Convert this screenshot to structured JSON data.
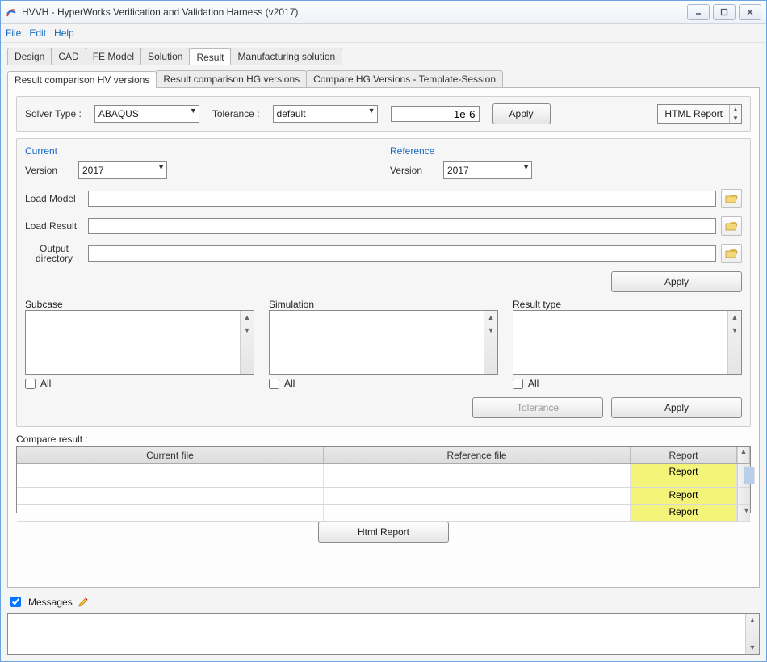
{
  "window": {
    "title": "HVVH - HyperWorks Verification and Validation Harness (v2017)"
  },
  "menu": {
    "file": "File",
    "edit": "Edit",
    "help": "Help"
  },
  "main_tabs": {
    "design": "Design",
    "cad": "CAD",
    "fe": "FE Model",
    "solution": "Solution",
    "result": "Result",
    "manuf": "Manufacturing solution"
  },
  "sub_tabs": {
    "hv": "Result comparison HV versions",
    "hg": "Result comparison HG versions",
    "tpl": "Compare HG Versions - Template-Session"
  },
  "toolbar": {
    "solver_label": "Solver Type :",
    "solver_value": "ABAQUS",
    "tol_label": "Tolerance :",
    "tol_value": "default",
    "num_value": "1e-6",
    "apply": "Apply",
    "html_report": "HTML Report"
  },
  "current": {
    "legend": "Current",
    "version_label": "Version",
    "version_value": "2017"
  },
  "reference": {
    "legend": "Reference",
    "version_label": "Version",
    "version_value": "2017"
  },
  "files": {
    "load_model": "Load Model",
    "load_result": "Load Result",
    "out_dir1": "Output",
    "out_dir2": "directory"
  },
  "apply2": "Apply",
  "lists": {
    "subcase": "Subcase",
    "simulation": "Simulation",
    "result_type": "Result type",
    "all": "All"
  },
  "footer_btns": {
    "tolerance": "Tolerance",
    "apply": "Apply"
  },
  "compare": {
    "title": "Compare result :",
    "col_current": "Current file",
    "col_reference": "Reference file",
    "col_report": "Report",
    "report_cell": "Report",
    "html_report_btn": "Html Report"
  },
  "messages": {
    "label": "Messages"
  }
}
